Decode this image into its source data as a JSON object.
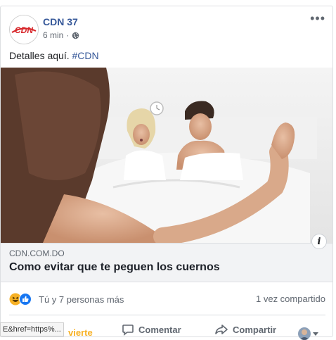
{
  "post": {
    "page_name": "CDN 37",
    "logo_text": "CDN",
    "time": "6 min",
    "separator": "·",
    "privacy_icon": "globe-icon",
    "more_icon": "more-options-icon",
    "more_glyph": "•••",
    "text": "Detalles aquí.",
    "hashtag": "#CDN"
  },
  "link": {
    "domain": "CDN.COM.DO",
    "title": "Como evitar que te peguen los cuernos",
    "info_glyph": "i"
  },
  "engagement": {
    "reaction_icons": [
      "haha-icon",
      "like-icon"
    ],
    "reactions_text": "Tú y 7 personas más",
    "shares_text": "1 vez compartido"
  },
  "actions": {
    "like_label": "vierte",
    "comment_label": "Comentar",
    "share_label": "Compartir"
  },
  "status_url": "E&href=https%...",
  "colors": {
    "brand_red": "#d7262a",
    "link_blue": "#365899",
    "meta_gray": "#606770",
    "like_blue": "#1877f2",
    "haha_yellow": "#f7b125"
  }
}
